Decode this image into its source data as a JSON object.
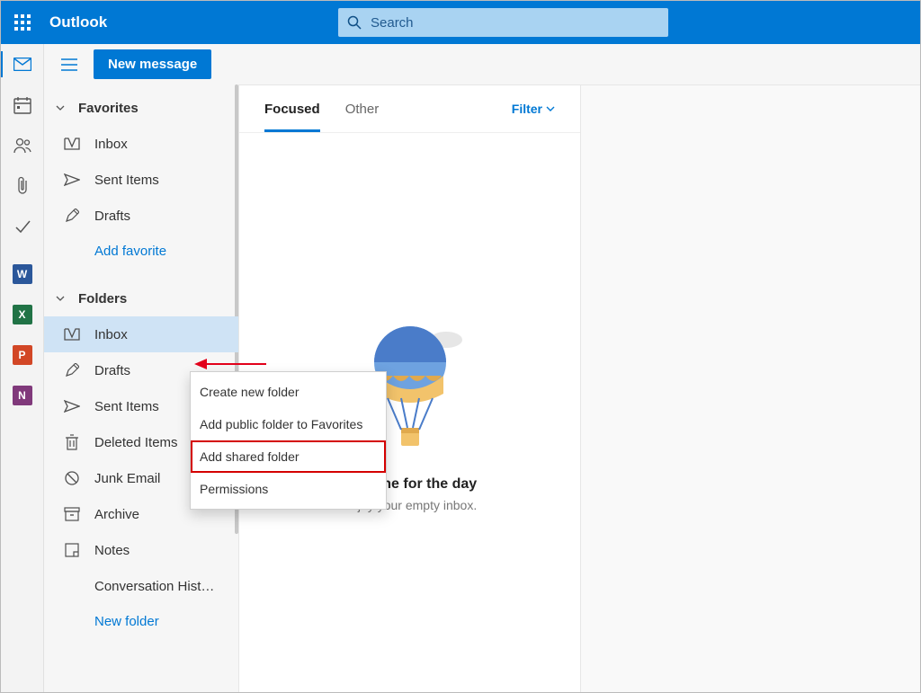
{
  "app": {
    "title": "Outlook"
  },
  "search": {
    "placeholder": "Search"
  },
  "commands": {
    "new_message": "New message"
  },
  "sidebar": {
    "favorites": {
      "header": "Favorites",
      "items": [
        {
          "label": "Inbox"
        },
        {
          "label": "Sent Items"
        },
        {
          "label": "Drafts"
        }
      ],
      "add_link": "Add favorite"
    },
    "folders": {
      "header": "Folders",
      "items": [
        {
          "label": "Inbox"
        },
        {
          "label": "Drafts"
        },
        {
          "label": "Sent Items"
        },
        {
          "label": "Deleted Items"
        },
        {
          "label": "Junk Email"
        },
        {
          "label": "Archive"
        },
        {
          "label": "Notes"
        },
        {
          "label": "Conversation Hist…"
        }
      ],
      "add_link": "New folder"
    }
  },
  "tabs": {
    "focused": "Focused",
    "other": "Other",
    "filter": "Filter"
  },
  "empty": {
    "title": "All done for the day",
    "sub": "Enjoy your empty inbox."
  },
  "context_menu": {
    "items": [
      {
        "label": "Create new folder"
      },
      {
        "label": "Add public folder to Favorites"
      },
      {
        "label": "Add shared folder"
      },
      {
        "label": "Permissions"
      }
    ]
  },
  "office_apps": {
    "word": "W",
    "excel": "X",
    "ppt": "P",
    "onenote": "N"
  }
}
